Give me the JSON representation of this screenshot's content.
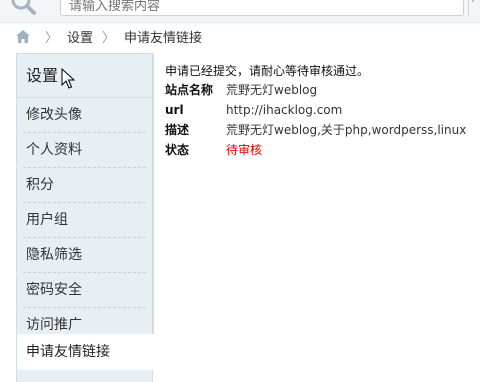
{
  "search": {
    "placeholder": "请输入搜索内容",
    "icon": "search-icon"
  },
  "breadcrumb": {
    "home_icon": "home-icon",
    "items": [
      "设置",
      "申请友情链接"
    ]
  },
  "sidebar": {
    "title": "设置",
    "items": [
      {
        "label": "修改头像"
      },
      {
        "label": "个人资料"
      },
      {
        "label": "积分"
      },
      {
        "label": "用户组"
      },
      {
        "label": "隐私筛选"
      },
      {
        "label": "密码安全"
      },
      {
        "label": "访问推广"
      }
    ],
    "active_item": "申请友情链接"
  },
  "main": {
    "notice": "申请已经提交，请耐心等待审核通过。",
    "fields": [
      {
        "key": "站点名称",
        "value": "荒野无灯weblog"
      },
      {
        "key": "url",
        "value": "http://ihacklog.com"
      },
      {
        "key": "描述",
        "value": "荒野无灯weblog,关于php,wordperss,linux"
      },
      {
        "key": "状态",
        "value": "待审核"
      }
    ]
  },
  "colors": {
    "sidebar_bg": "#e7eff5",
    "status_pending": "#e00000"
  }
}
